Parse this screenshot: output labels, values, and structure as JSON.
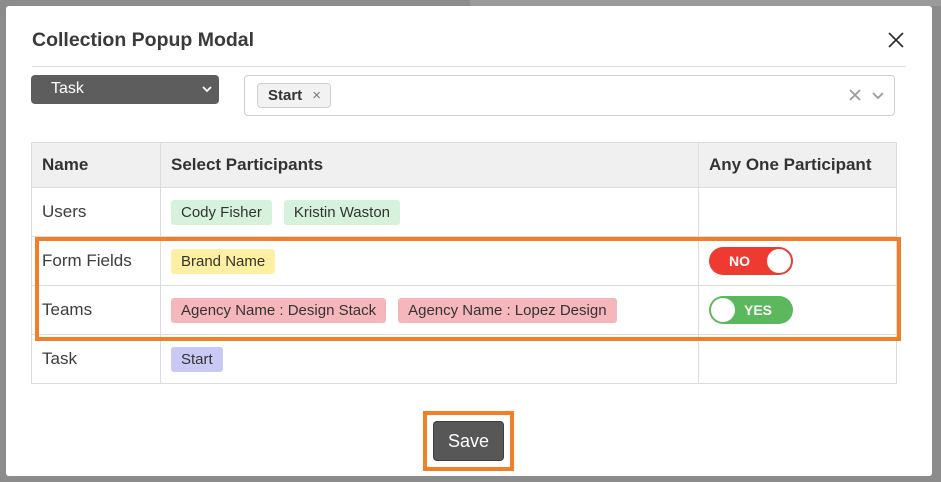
{
  "modal": {
    "title": "Collection Popup Modal"
  },
  "controls": {
    "type_select_value": "Task",
    "selected_chip": "Start",
    "chip_remove": "×"
  },
  "table": {
    "headers": [
      "Name",
      "Select Participants",
      "Any One Participant"
    ],
    "rows": [
      {
        "name": "Users",
        "participants": [
          "Cody Fisher",
          "Kristin Waston"
        ],
        "tag_color": "#d6f2dd"
      },
      {
        "name": "Form Fields",
        "participants": [
          "Brand Name"
        ],
        "tag_color": "#fdf0a2",
        "any_one": {
          "state": "off",
          "label": "NO"
        }
      },
      {
        "name": "Teams",
        "participants": [
          "Agency Name : Design Stack",
          "Agency Name : Lopez Design"
        ],
        "tag_color": "#f6b7bc",
        "any_one": {
          "state": "on",
          "label": "YES"
        }
      },
      {
        "name": "Task",
        "participants": [
          "Start"
        ],
        "tag_color": "#c9c9f5"
      }
    ]
  },
  "footer": {
    "save_label": "Save"
  },
  "colors": {
    "highlight": "#f27e25",
    "toggle_off": "#ef3a32",
    "toggle_on": "#5bb85c",
    "button": "#575757"
  },
  "icons": {
    "close": "close-icon",
    "dropdown": "chevron-down-icon",
    "clear": "clear-icon"
  }
}
